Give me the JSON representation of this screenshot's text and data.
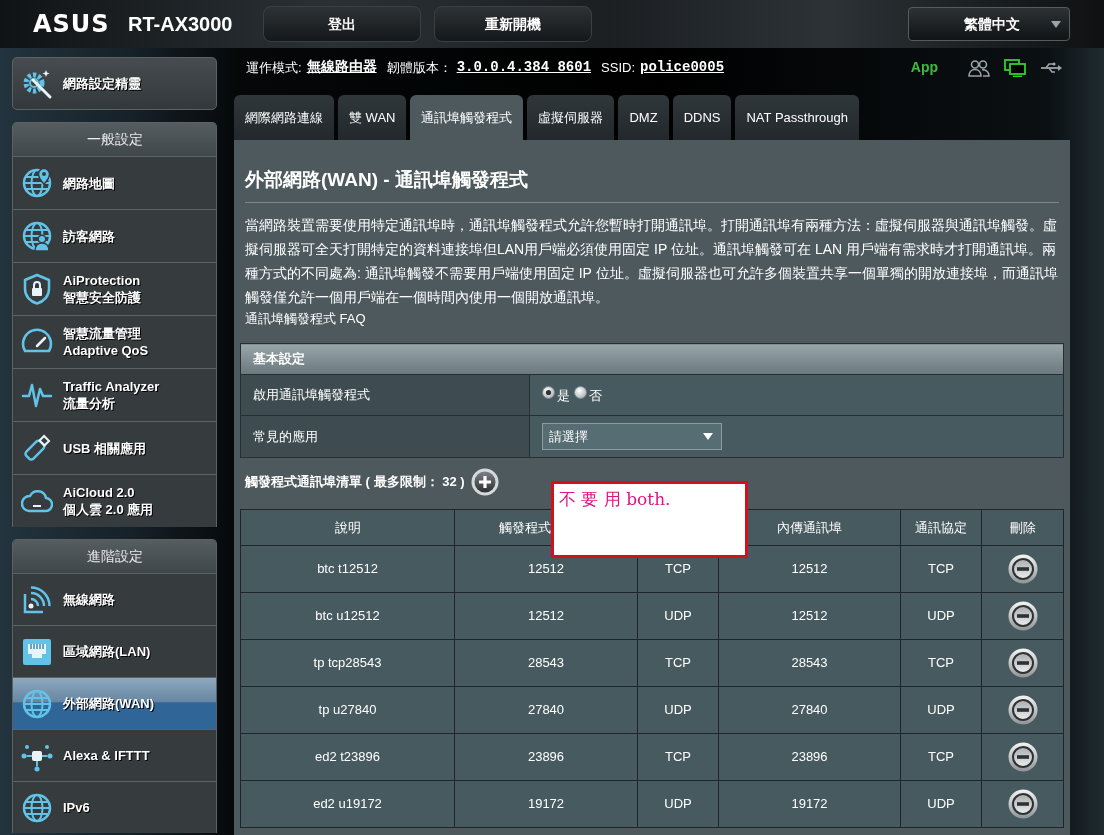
{
  "header": {
    "brand": "ASUS",
    "model": "RT-AX3000",
    "buttons": [
      "登出",
      "重新開機"
    ],
    "language": "繁體中文"
  },
  "status_line": {
    "items": [
      {
        "label": "運作模式:",
        "value": "無線路由器"
      },
      {
        "label": "韌體版本：",
        "value": "3.0.0.4.384_8601"
      },
      {
        "label": "SSID:",
        "value": "police0005"
      }
    ],
    "app_label": "App",
    "icons": [
      {
        "kind": "clients",
        "active": false
      },
      {
        "kind": "network",
        "active": true
      },
      {
        "kind": "usb",
        "active": false
      }
    ]
  },
  "sidebar": {
    "wizard": {
      "kind": "wizard",
      "lines": [
        "網路設定精靈"
      ]
    },
    "sections": [
      {
        "title": "一般設定",
        "items": [
          {
            "kind": "map",
            "lines": [
              "網路地圖"
            ],
            "selected": false
          },
          {
            "kind": "guest",
            "lines": [
              "訪客網路"
            ],
            "selected": false
          },
          {
            "kind": "shield",
            "lines": [
              "AiProtection",
              "智慧安全防護"
            ],
            "selected": false
          },
          {
            "kind": "gauge",
            "lines": [
              "智慧流量管理",
              "Adaptive QoS"
            ],
            "selected": false
          },
          {
            "kind": "pulse",
            "lines": [
              "Traffic Analyzer",
              "流量分析"
            ],
            "selected": false
          },
          {
            "kind": "usb",
            "lines": [
              "USB 相關應用"
            ],
            "selected": false
          },
          {
            "kind": "cloud",
            "lines": [
              "AiCloud 2.0",
              "個人雲 2.0 應用"
            ],
            "selected": false
          }
        ]
      },
      {
        "title": "進階設定",
        "items": [
          {
            "kind": "wifi",
            "lines": [
              "無線網路"
            ],
            "selected": false
          },
          {
            "kind": "lan",
            "lines": [
              "區域網路(LAN)"
            ],
            "selected": false
          },
          {
            "kind": "globe",
            "lines": [
              "外部網路(WAN)"
            ],
            "selected": true
          },
          {
            "kind": "hub",
            "lines": [
              "Alexa & IFTTT"
            ],
            "selected": false
          },
          {
            "kind": "globe",
            "lines": [
              "IPv6"
            ],
            "selected": false
          }
        ]
      }
    ]
  },
  "tabs": [
    {
      "label": "網際網路連線",
      "selected": false
    },
    {
      "label": "雙 WAN",
      "selected": false
    },
    {
      "label": "通訊埠觸發程式",
      "selected": true
    },
    {
      "label": "虛擬伺服器",
      "selected": false
    },
    {
      "label": "DMZ",
      "selected": false
    },
    {
      "label": "DDNS",
      "selected": false
    },
    {
      "label": "NAT Passthrough",
      "selected": false
    }
  ],
  "page": {
    "title": "外部網路(WAN) - 通訊埠觸發程式",
    "description": "當網路裝置需要使用特定通訊埠時，通訊埠觸發程式允許您暫時打開通訊埠。打開通訊埠有兩種方法：虛擬伺服器與通訊埠觸發。虛擬伺服器可全天打開特定的資料連接埠但LAN用戶端必須使用固定 IP 位址。通訊埠觸發可在 LAN 用戶端有需求時才打開通訊埠。兩種方式的不同處為: 通訊埠觸發不需要用戶端使用固定 IP 位址。虛擬伺服器也可允許多個裝置共享一個單獨的開放連接埠，而通訊埠觸發僅允許一個用戶端在一個時間內使用一個開放通訊埠。",
    "faq_link": "通訊埠觸發程式 FAQ"
  },
  "basic_settings": {
    "title": "基本設定",
    "rows": [
      {
        "kind": "radio",
        "label": "啟用通訊埠觸發程式",
        "options": [
          {
            "label": "是",
            "selected": true
          },
          {
            "label": "否",
            "selected": false
          }
        ]
      },
      {
        "kind": "select",
        "label": "常見的應用",
        "value": "請選擇"
      }
    ]
  },
  "trigger_list": {
    "title": "觸發程式通訊埠清單 ( 最多限制： 32 )",
    "columns": [
      "說明",
      "觸發程式",
      null,
      "內傳通訊埠",
      "通訊協定",
      "刪除"
    ],
    "rows": [
      [
        "btc t12512",
        "12512",
        "TCP",
        "12512",
        "TCP"
      ],
      [
        "btc u12512",
        "12512",
        "UDP",
        "12512",
        "UDP"
      ],
      [
        "tp tcp28543",
        "28543",
        "TCP",
        "28543",
        "TCP"
      ],
      [
        "tp u27840",
        "27840",
        "UDP",
        "27840",
        "UDP"
      ],
      [
        "ed2 t23896",
        "23896",
        "TCP",
        "23896",
        "TCP"
      ],
      [
        "ed2 u19172",
        "19172",
        "UDP",
        "19172",
        "UDP"
      ]
    ]
  },
  "annotation": {
    "text": "不 要 用 both."
  }
}
